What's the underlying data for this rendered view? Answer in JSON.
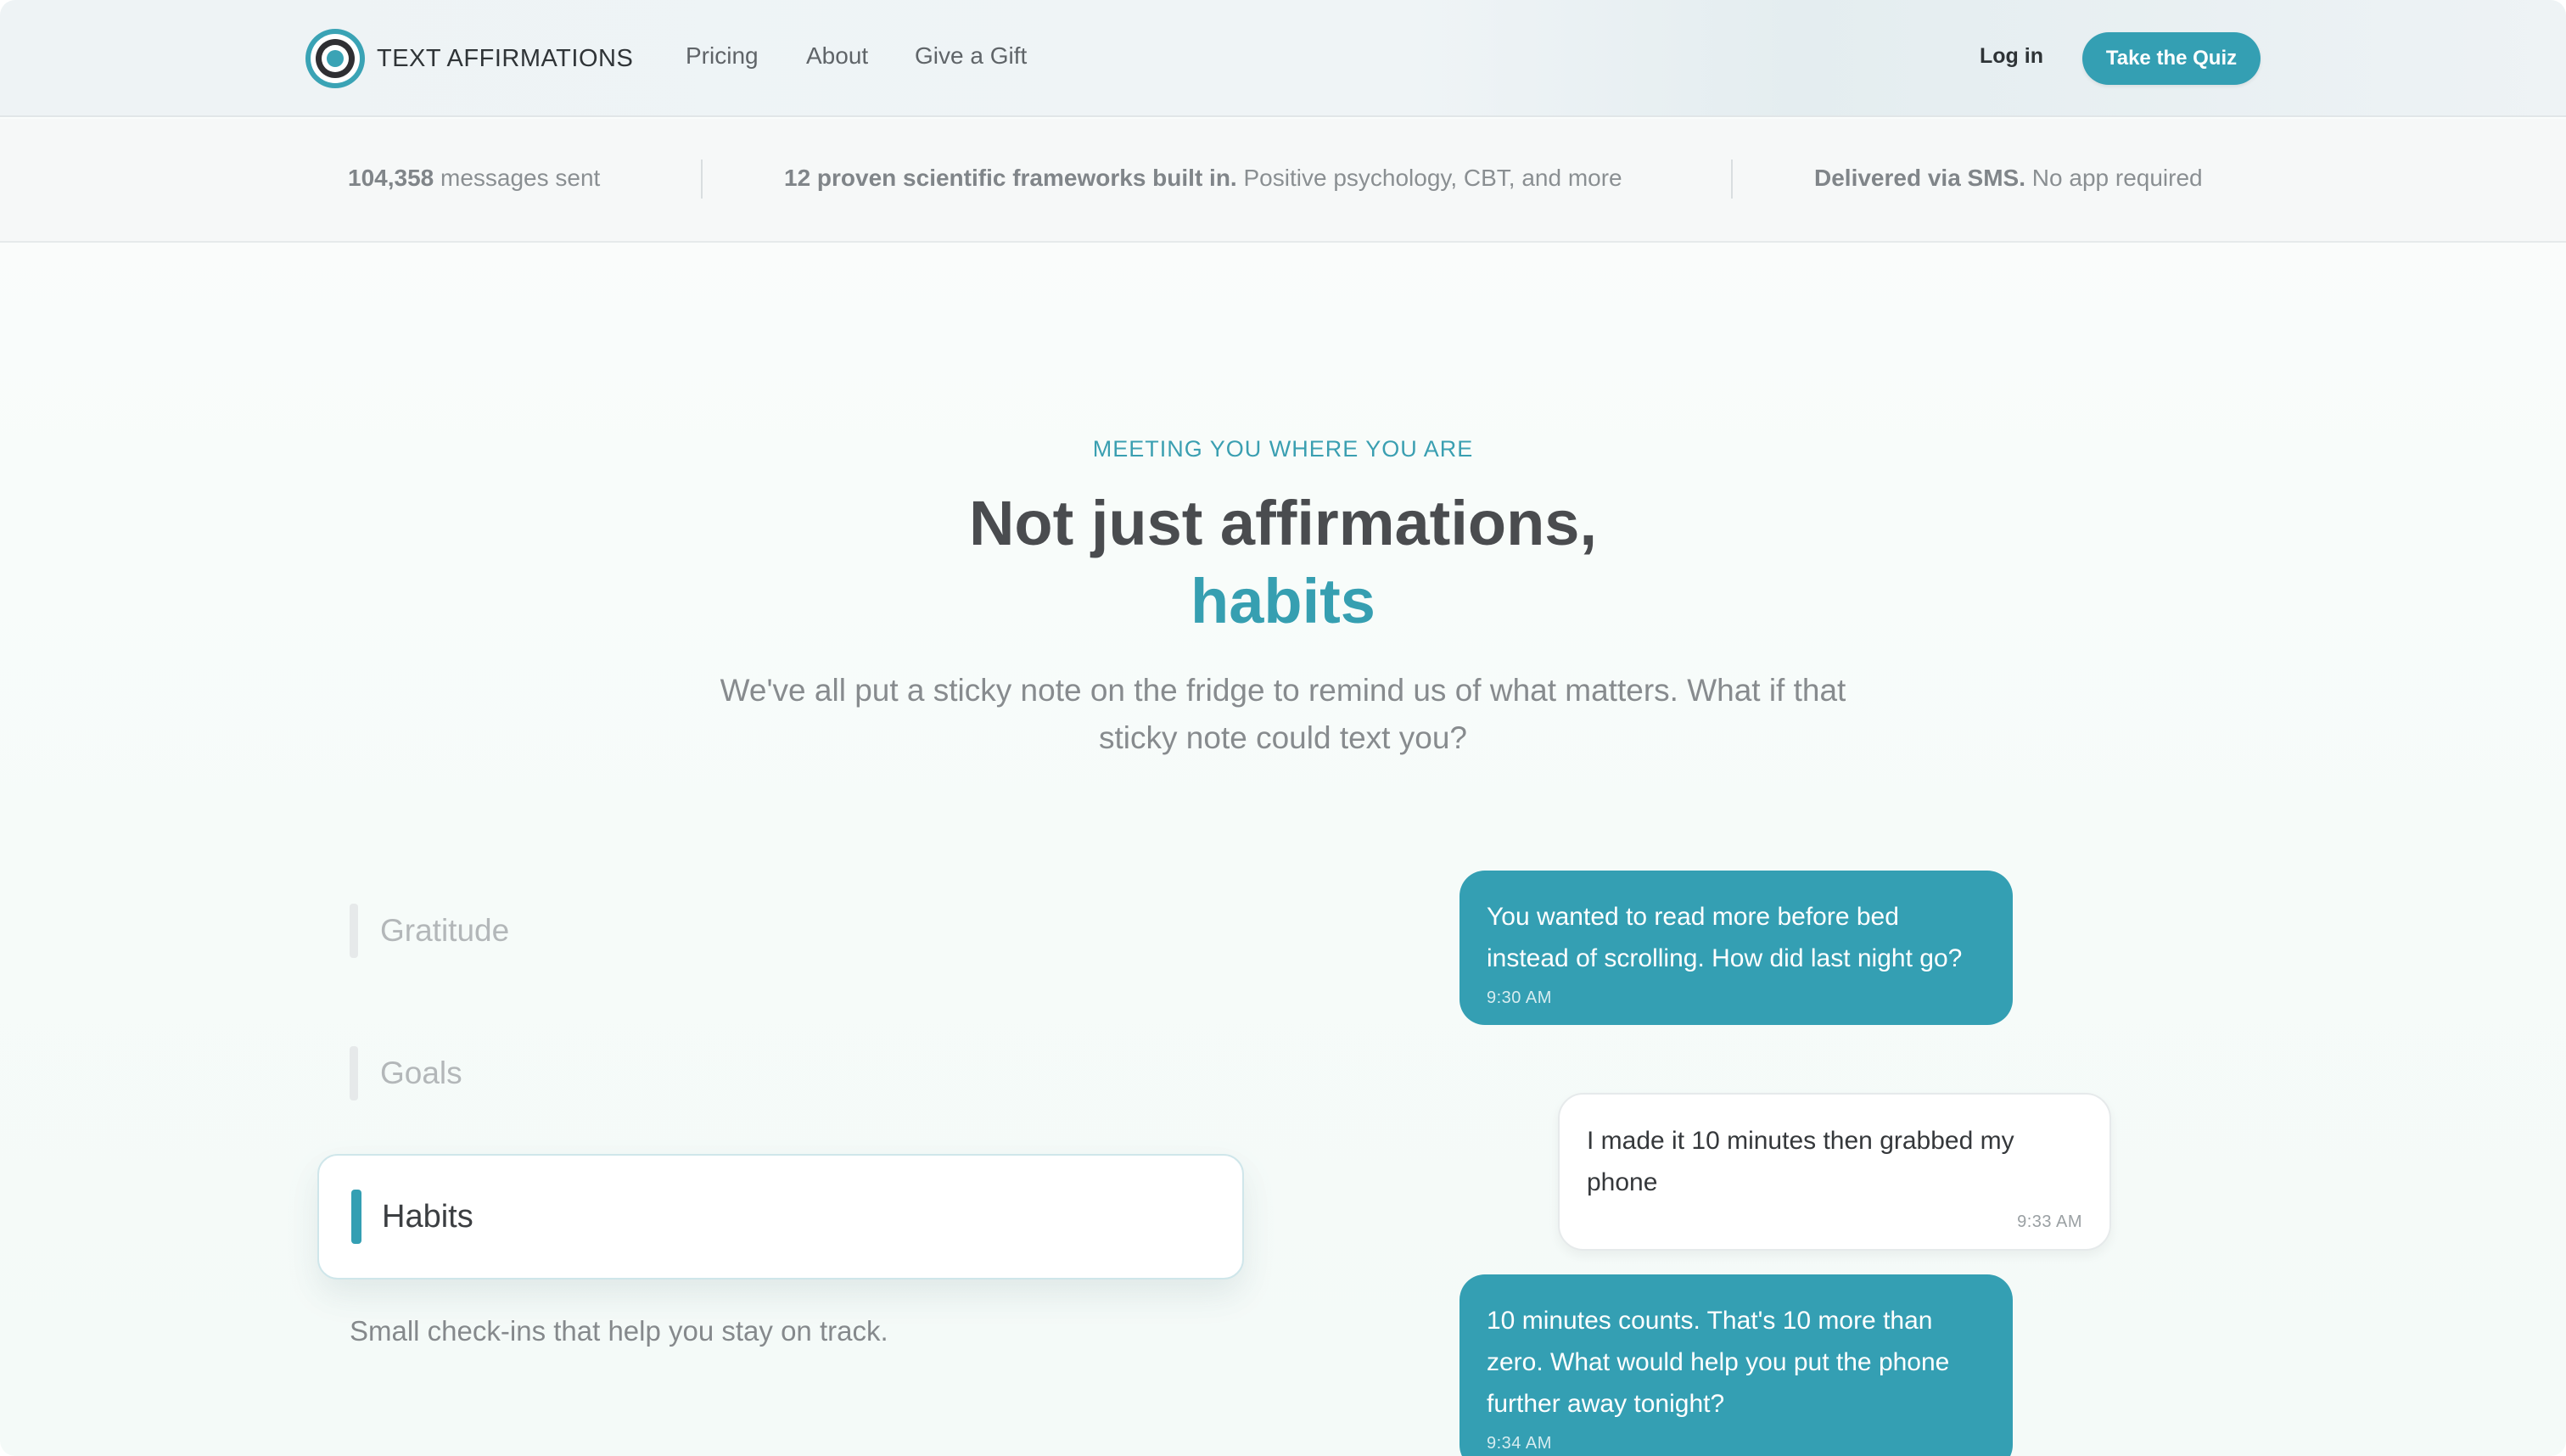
{
  "nav": {
    "brand": "TEXT AFFIRMATIONS",
    "links": [
      "Pricing",
      "About",
      "Give a Gift"
    ],
    "login": "Log in",
    "cta": "Take the Quiz"
  },
  "stats": [
    {
      "bold": "104,358",
      "rest": " messages sent"
    },
    {
      "bold": "12 proven scientific frameworks built in.",
      "rest": " Positive psychology, CBT, and more"
    },
    {
      "bold": "Delivered via SMS.",
      "rest": " No app required"
    }
  ],
  "hero": {
    "eyebrow": "MEETING YOU WHERE YOU ARE",
    "headline": "Not just affirmations,",
    "headline_accent": "habits",
    "subtext": "We've all put a sticky note on the fridge to remind us of what matters. What if that sticky note could text you?"
  },
  "tabs": {
    "items": [
      "Gratitude",
      "Goals",
      "Habits"
    ],
    "active_index": 2,
    "active_description": "Small check-ins that help you stay on track."
  },
  "chat": [
    {
      "from": "app",
      "text": "You wanted to read more before bed instead of scrolling. How did last night go?",
      "time": "9:30 AM"
    },
    {
      "from": "user",
      "text": "I made it 10 minutes then grabbed my phone",
      "time": "9:33 AM"
    },
    {
      "from": "app",
      "text": "10 minutes counts. That's 10 more than zero. What would help you put the phone further away tonight?",
      "time": "9:34 AM"
    }
  ],
  "colors": {
    "accent": "#349fb3",
    "heading": "#4a4c4f",
    "muted": "#878b8e"
  }
}
